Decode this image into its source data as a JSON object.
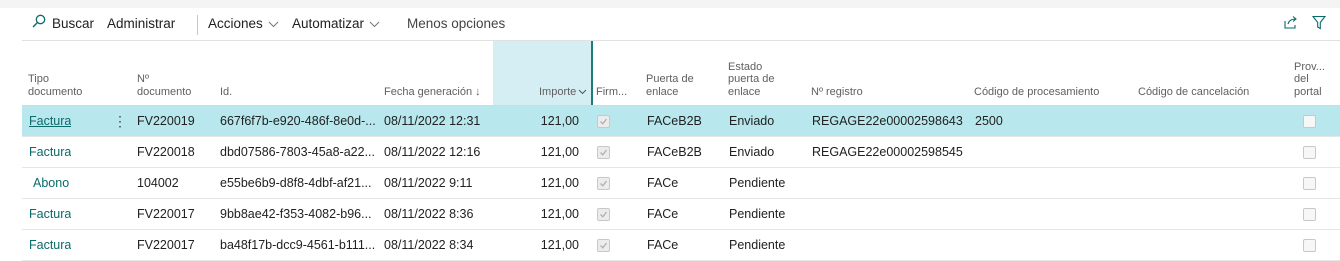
{
  "toolbar": {
    "search_label": "Buscar",
    "manage_label": "Administrar",
    "actions_label": "Acciones",
    "automate_label": "Automatizar",
    "less_options_label": "Menos opciones"
  },
  "columns": {
    "tipo_documento": [
      "Tipo",
      "documento"
    ],
    "n_documento": [
      "Nº",
      "documento"
    ],
    "id": "Id.",
    "fecha_generacion": "Fecha generación ↓",
    "importe": "Importe",
    "firmado": "Firm...",
    "puerta_enlace": [
      "Puerta de",
      "enlace"
    ],
    "estado_puerta": [
      "Estado",
      "puerta de",
      "enlace"
    ],
    "n_registro": "Nº registro",
    "codigo_procesamiento": "Código de procesamiento",
    "codigo_cancelacion": "Código de cancelación",
    "prov_portal": [
      "Prov...",
      "del",
      "portal"
    ]
  },
  "rows": [
    {
      "tipo": "Factura",
      "numero": "FV220019",
      "id": "667f6f7b-e920-486f-8e0d-...",
      "fecha": "08/11/2022 12:31",
      "importe": "121,00",
      "firmado": true,
      "puerta": "FACeB2B",
      "estado": "Enviado",
      "registro": "REGAGE22e00002598643",
      "cod_proc": "2500",
      "cod_canc": "",
      "prov_portal": false
    },
    {
      "tipo": "Factura",
      "numero": "FV220018",
      "id": "dbd07586-7803-45a8-a22...",
      "fecha": "08/11/2022 12:16",
      "importe": "121,00",
      "firmado": true,
      "puerta": "FACeB2B",
      "estado": "Enviado",
      "registro": "REGAGE22e00002598545",
      "cod_proc": "",
      "cod_canc": "",
      "prov_portal": false
    },
    {
      "tipo": "Abono",
      "numero": "104002",
      "id": "e55be6b9-d8f8-4dbf-af21...",
      "fecha": "08/11/2022 9:11",
      "importe": "121,00",
      "firmado": true,
      "puerta": "FACe",
      "estado": "Pendiente",
      "registro": "",
      "cod_proc": "",
      "cod_canc": "",
      "prov_portal": false
    },
    {
      "tipo": "Factura",
      "numero": "FV220017",
      "id": "9bb8ae42-f353-4082-b96...",
      "fecha": "08/11/2022 8:36",
      "importe": "121,00",
      "firmado": true,
      "puerta": "FACe",
      "estado": "Pendiente",
      "registro": "",
      "cod_proc": "",
      "cod_canc": "",
      "prov_portal": false
    },
    {
      "tipo": "Factura",
      "numero": "FV220017",
      "id": "ba48f17b-dcc9-4561-b111...",
      "fecha": "08/11/2022 8:34",
      "importe": "121,00",
      "firmado": true,
      "puerta": "FACe",
      "estado": "Pendiente",
      "registro": "",
      "cod_proc": "",
      "cod_canc": "",
      "prov_portal": false
    }
  ],
  "colors": {
    "accent": "#0b6a6a",
    "selected_row": "#b8e8ed",
    "importe_header": "#d5eef3"
  },
  "icons": [
    "search-icon",
    "chevron-down-icon",
    "share-icon",
    "filter-icon",
    "sort-down-arrow",
    "checkbox"
  ]
}
